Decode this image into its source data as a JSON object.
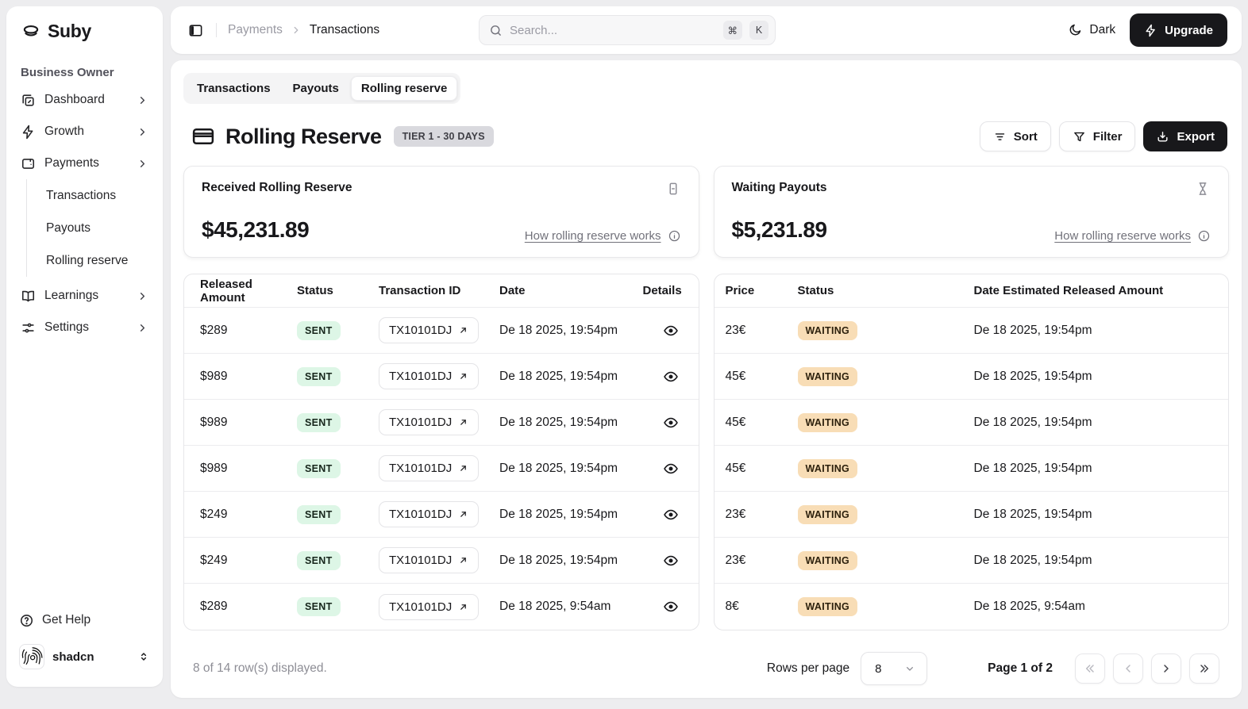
{
  "brand": {
    "name": "Suby"
  },
  "sidebar": {
    "section_label": "Business Owner",
    "items": [
      {
        "label": "Dashboard"
      },
      {
        "label": "Growth"
      },
      {
        "label": "Payments",
        "children": [
          "Transactions",
          "Payouts",
          "Rolling reserve"
        ]
      },
      {
        "label": "Learnings"
      },
      {
        "label": "Settings"
      }
    ],
    "help_label": "Get Help",
    "user_name": "shadcn"
  },
  "topbar": {
    "breadcrumb": {
      "parent": "Payments",
      "current": "Transactions"
    },
    "search": {
      "placeholder": "Search...",
      "kbd_cmd": "⌘",
      "kbd_key": "K"
    },
    "theme_label": "Dark",
    "upgrade_label": "Upgrade"
  },
  "page": {
    "tabs": [
      {
        "label": "Transactions"
      },
      {
        "label": "Payouts"
      },
      {
        "label": "Rolling reserve"
      }
    ],
    "title": "Rolling Reserve",
    "tier_badge": "TIER 1 - 30 DAYS",
    "actions": {
      "sort": "Sort",
      "filter": "Filter",
      "export": "Export"
    }
  },
  "summary_cards": [
    {
      "label": "Received Rolling Reserve",
      "amount": "$45,231.89",
      "link": "How rolling reserve works",
      "icon": "receipt-icon"
    },
    {
      "label": "Waiting Payouts",
      "amount": "$5,231.89",
      "link": "How rolling reserve works",
      "icon": "hourglass-icon"
    }
  ],
  "released_table": {
    "columns": [
      "Released Amount",
      "Status",
      "Transaction ID",
      "Date",
      "Details"
    ],
    "rows": [
      {
        "amount": "$289",
        "status": "SENT",
        "tx": "TX10101DJ",
        "date": "De 18 2025, 19:54pm"
      },
      {
        "amount": "$989",
        "status": "SENT",
        "tx": "TX10101DJ",
        "date": "De 18 2025, 19:54pm"
      },
      {
        "amount": "$989",
        "status": "SENT",
        "tx": "TX10101DJ",
        "date": "De 18 2025, 19:54pm"
      },
      {
        "amount": "$989",
        "status": "SENT",
        "tx": "TX10101DJ",
        "date": "De 18 2025, 19:54pm"
      },
      {
        "amount": "$249",
        "status": "SENT",
        "tx": "TX10101DJ",
        "date": "De 18 2025, 19:54pm"
      },
      {
        "amount": "$249",
        "status": "SENT",
        "tx": "TX10101DJ",
        "date": "De 18 2025, 19:54pm"
      },
      {
        "amount": "$289",
        "status": "SENT",
        "tx": "TX10101DJ",
        "date": "De 18 2025, 9:54am"
      }
    ]
  },
  "waiting_table": {
    "columns": [
      "Price",
      "Status",
      "Date Estimated Released Amount"
    ],
    "rows": [
      {
        "price": "23€",
        "status": "WAITING",
        "date": "De 18 2025, 19:54pm"
      },
      {
        "price": "45€",
        "status": "WAITING",
        "date": "De 18 2025, 19:54pm"
      },
      {
        "price": "45€",
        "status": "WAITING",
        "date": "De 18 2025, 19:54pm"
      },
      {
        "price": "45€",
        "status": "WAITING",
        "date": "De 18 2025, 19:54pm"
      },
      {
        "price": "23€",
        "status": "WAITING",
        "date": "De 18 2025, 19:54pm"
      },
      {
        "price": "23€",
        "status": "WAITING",
        "date": "De 18 2025, 19:54pm"
      },
      {
        "price": "8€",
        "status": "WAITING",
        "date": "De 18 2025, 9:54am"
      }
    ]
  },
  "pagination": {
    "rows_displayed": "8 of 14 row(s) displayed.",
    "rows_per_page_label": "Rows per page",
    "rows_per_page_value": "8",
    "page_label": "Page 1 of 2"
  },
  "colors": {
    "sent_bg": "#ddf6e6",
    "sent_text": "#16251b",
    "waiting_bg": "#f8ddb6",
    "waiting_text": "#2d210d",
    "primary": "#18181b",
    "page_bg": "#ededef"
  }
}
